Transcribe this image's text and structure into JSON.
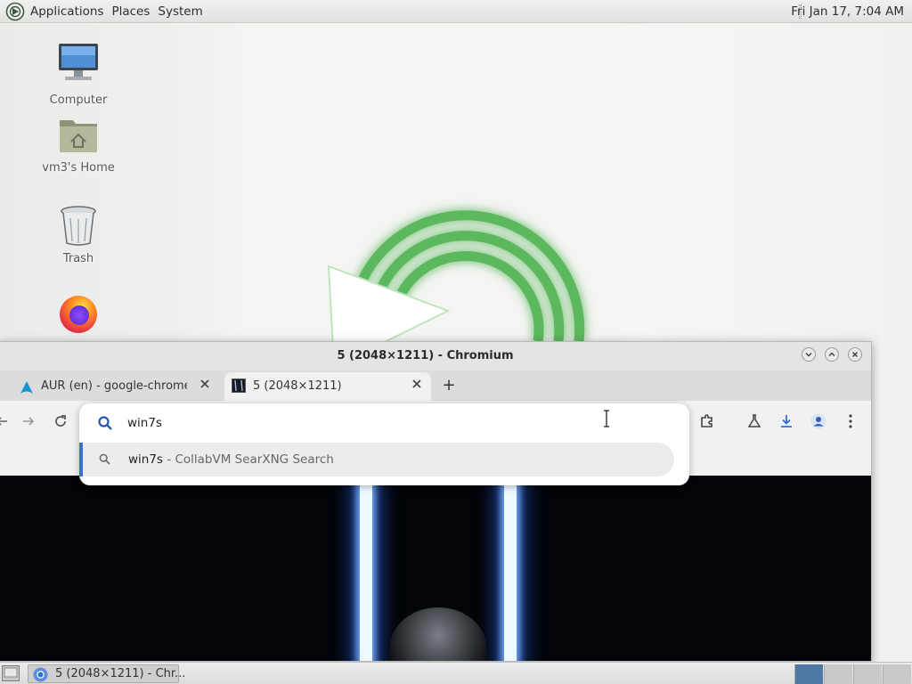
{
  "top_panel": {
    "menus": [
      "Applications",
      "Places",
      "System"
    ],
    "clock": "Fri Jan 17,  7:04 AM"
  },
  "desktop_icons": [
    {
      "label": "Computer",
      "icon": "computer-icon"
    },
    {
      "label": "vm3's Home",
      "icon": "home-folder-icon"
    },
    {
      "label": "Trash",
      "icon": "trash-icon"
    },
    {
      "label": "",
      "icon": "firefox-icon"
    }
  ],
  "browser": {
    "title": "5 (2048×1211) - Chromium",
    "tabs": [
      {
        "label": "AUR (en) - google-chrome-d",
        "favicon": "arch-icon",
        "active": false
      },
      {
        "label": "5 (2048×1211)",
        "favicon": "image-icon",
        "active": true
      }
    ],
    "new_tab": "+",
    "window_controls": [
      "minimize",
      "maximize",
      "close"
    ]
  },
  "omnibox": {
    "value": "win7s",
    "suggestion_query": "win7s",
    "suggestion_source": " - CollabVM SearXNG Search"
  },
  "taskbar": {
    "tasks": [
      {
        "label": "5 (2048×1211) - Chr...",
        "icon": "chromium-icon"
      }
    ],
    "workspaces": 4
  },
  "colors": {
    "accent": "#3b6fd0",
    "wallpaper_logo": "#5cb85c",
    "workspace_active": "#4f78a6"
  }
}
